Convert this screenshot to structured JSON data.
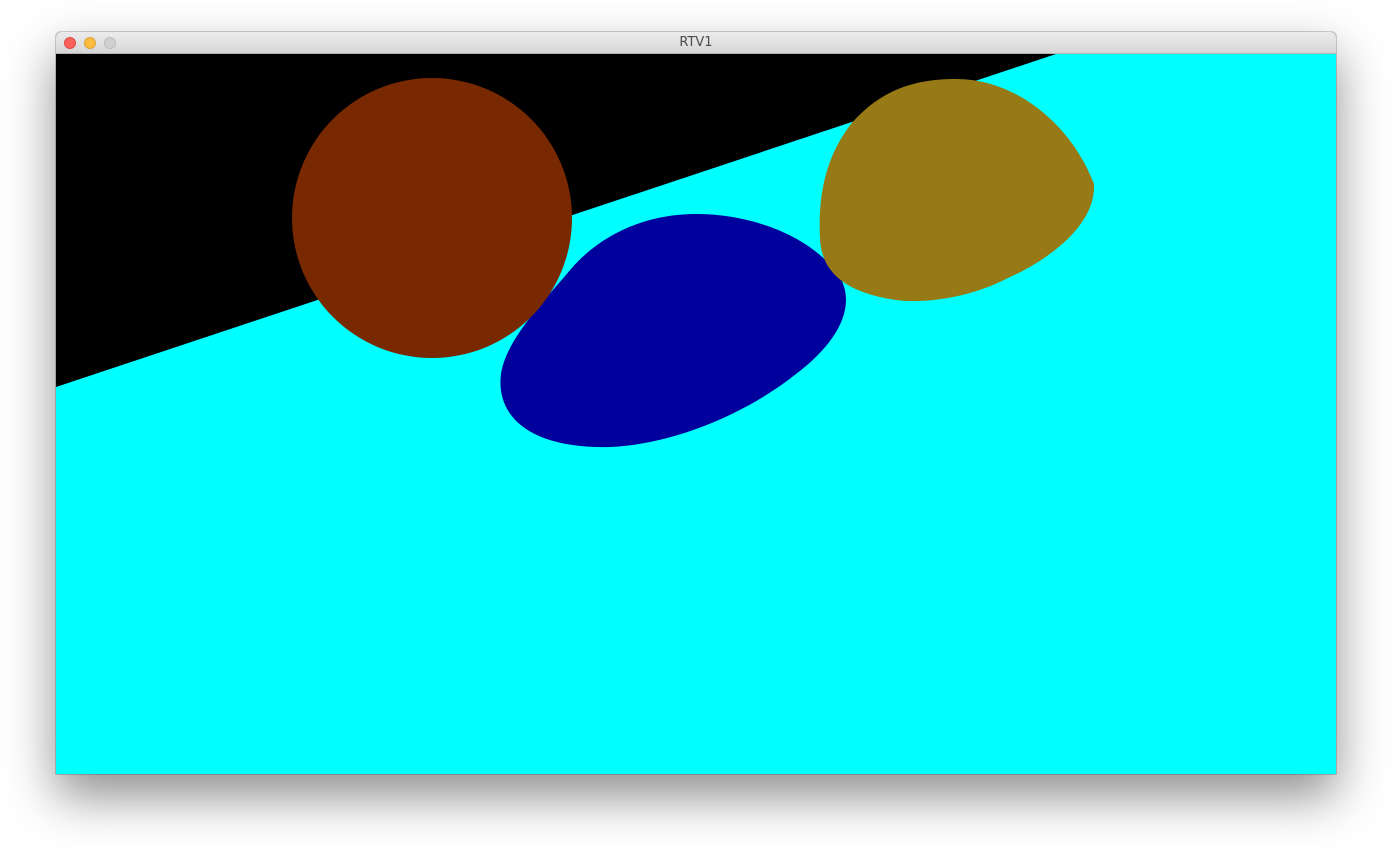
{
  "window": {
    "title": "RTV1"
  },
  "scene": {
    "background_color": "#000000",
    "objects": [
      {
        "name": "plane",
        "color": "#00ffff"
      },
      {
        "name": "sphere-brown",
        "color": "#782902"
      },
      {
        "name": "ellipsoid-blue",
        "color": "#00009c"
      },
      {
        "name": "ellipsoid-gold",
        "color": "#977915"
      }
    ]
  }
}
